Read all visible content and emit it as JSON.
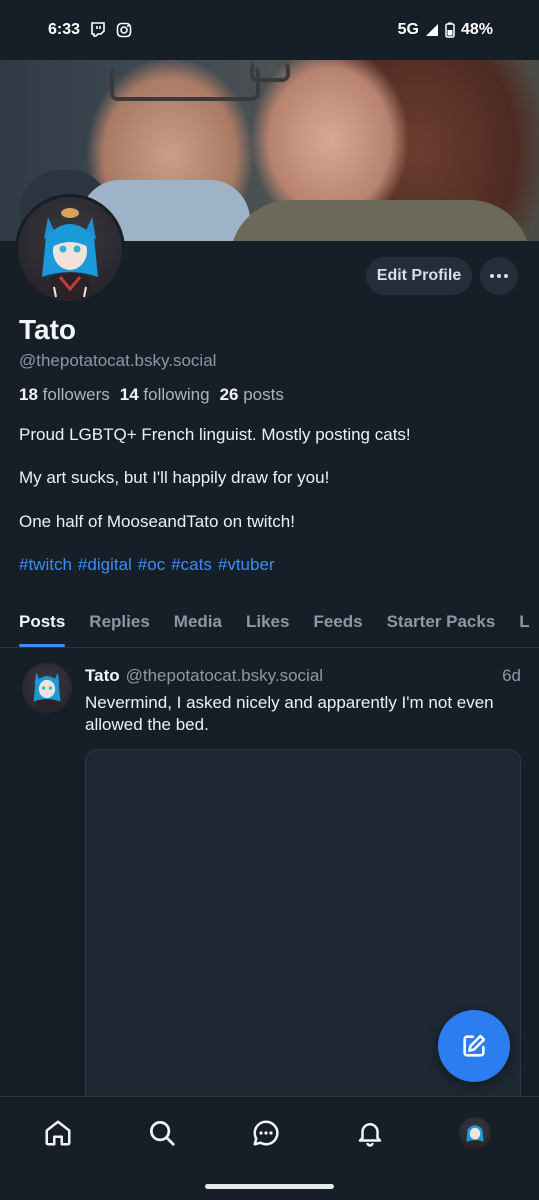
{
  "status_bar": {
    "time": "6:33",
    "network": "5G",
    "battery": "48%"
  },
  "profile": {
    "display_name": "Tato",
    "handle": "@thepotatocat.bsky.social",
    "edit_label": "Edit Profile",
    "followers_count": "18",
    "followers_label": "followers",
    "following_count": "14",
    "following_label": "following",
    "posts_count": "26",
    "posts_label": "posts",
    "bio_lines": [
      "Proud LGBTQ+ French linguist. Mostly posting cats!",
      "My art sucks, but I'll happily draw for you!",
      "One half of MooseandTato on twitch!"
    ],
    "hashtags": [
      "#twitch",
      "#digital",
      "#oc",
      "#cats",
      "#vtuber"
    ]
  },
  "tabs": [
    "Posts",
    "Replies",
    "Media",
    "Likes",
    "Feeds",
    "Starter Packs",
    "L"
  ],
  "post": {
    "author": "Tato",
    "handle": "@thepotatocat.bsky.social",
    "time": "6d",
    "text": "Nevermind, I asked nicely and apparently I'm not even allowed the bed."
  },
  "nav": [
    "home-icon",
    "search-icon",
    "chat-icon",
    "bell-icon",
    "avatar"
  ],
  "colors": {
    "accent": "#3a8df5",
    "fab": "#2c7df0",
    "background": "#161e27"
  }
}
